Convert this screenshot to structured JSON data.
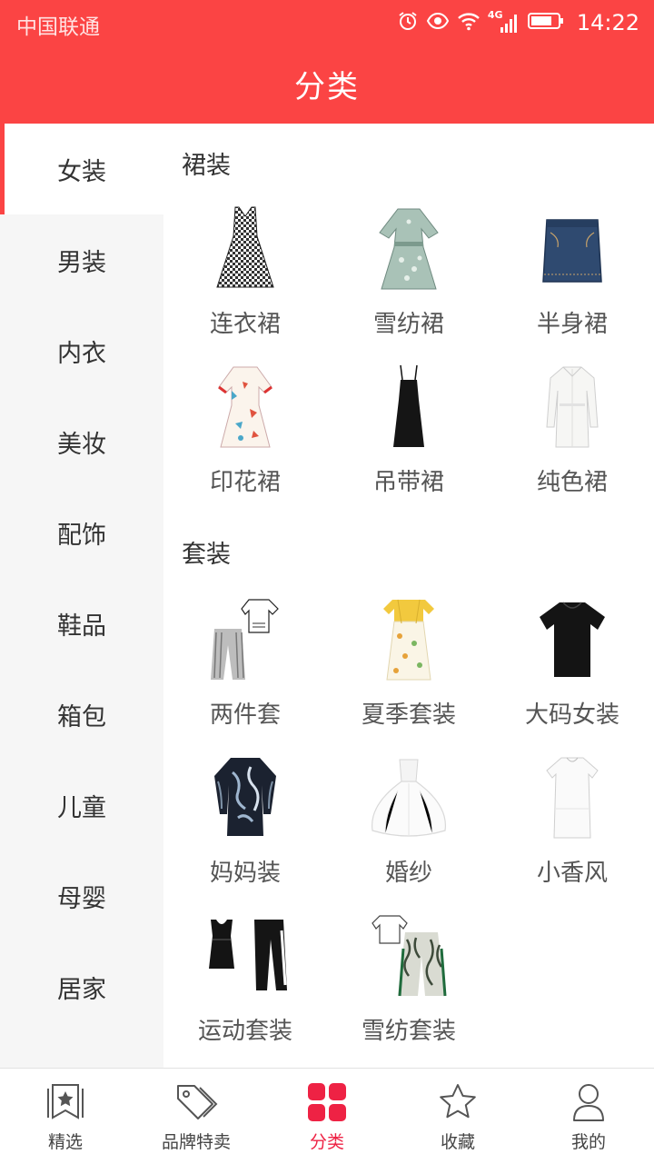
{
  "status_bar": {
    "carrier": "中国联通",
    "time": "14:22",
    "network": "4G"
  },
  "header": {
    "title": "分类"
  },
  "sidebar": {
    "items": [
      {
        "label": "女装",
        "active": true
      },
      {
        "label": "男装"
      },
      {
        "label": "内衣"
      },
      {
        "label": "美妆"
      },
      {
        "label": "配饰"
      },
      {
        "label": "鞋品"
      },
      {
        "label": "箱包"
      },
      {
        "label": "儿童"
      },
      {
        "label": "母婴"
      },
      {
        "label": "居家"
      }
    ]
  },
  "sections": [
    {
      "title": "裙装",
      "items": [
        {
          "label": "连衣裙",
          "icon": "plaid-dress-icon"
        },
        {
          "label": "雪纺裙",
          "icon": "floral-chiffon-dress-icon"
        },
        {
          "label": "半身裙",
          "icon": "denim-skirt-icon"
        },
        {
          "label": "印花裙",
          "icon": "print-dress-icon"
        },
        {
          "label": "吊带裙",
          "icon": "slip-dress-icon"
        },
        {
          "label": "纯色裙",
          "icon": "white-shirt-dress-icon"
        }
      ]
    },
    {
      "title": "套装",
      "items": [
        {
          "label": "两件套",
          "icon": "two-piece-set-icon"
        },
        {
          "label": "夏季套装",
          "icon": "summer-set-icon"
        },
        {
          "label": "大码女装",
          "icon": "black-tshirt-icon"
        },
        {
          "label": "妈妈装",
          "icon": "printed-blouse-icon"
        },
        {
          "label": "婚纱",
          "icon": "wedding-gown-icon"
        },
        {
          "label": "小香风",
          "icon": "white-short-dress-icon"
        },
        {
          "label": "运动套装",
          "icon": "sport-set-icon"
        },
        {
          "label": "雪纺套装",
          "icon": "chiffon-set-icon"
        }
      ]
    }
  ],
  "tabbar": {
    "items": [
      {
        "label": "精选",
        "icon": "bookmark-star-icon"
      },
      {
        "label": "品牌特卖",
        "icon": "price-tag-icon"
      },
      {
        "label": "分类",
        "icon": "category-grid-icon",
        "active": true
      },
      {
        "label": "收藏",
        "icon": "star-icon"
      },
      {
        "label": "我的",
        "icon": "user-icon"
      }
    ]
  },
  "colors": {
    "accent": "#fb4444",
    "active_tab": "#ee2244",
    "sidebar_bg": "#f6f6f6"
  }
}
